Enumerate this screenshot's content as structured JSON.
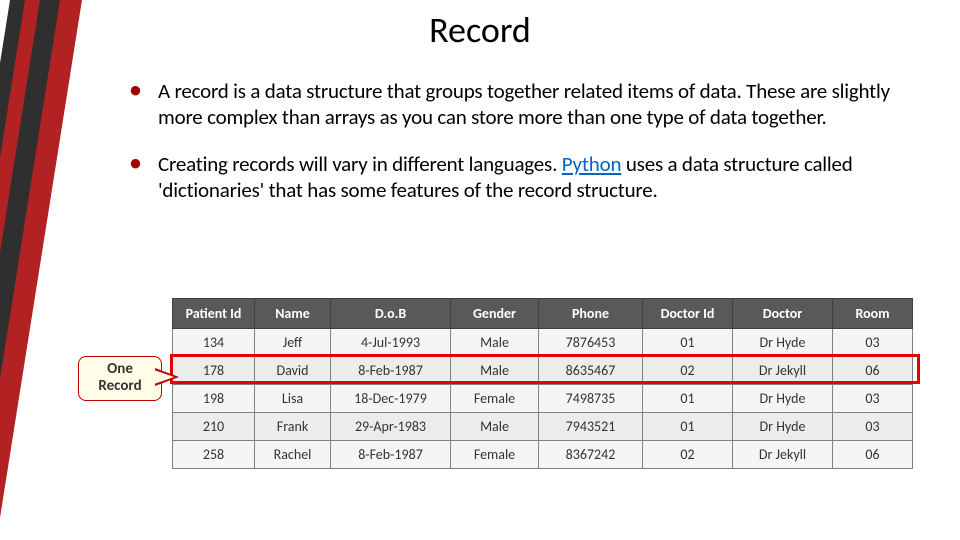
{
  "title": "Record",
  "bullets": [
    {
      "prefix": "A record is a data structure that groups together related items of data. These are slightly more complex than arrays as you can store more than one type of data together."
    },
    {
      "prefix": "Creating records will vary in different languages. ",
      "link_text": "Python",
      "suffix": " uses a data structure called 'dictionaries' that has some features of the record structure."
    }
  ],
  "callout": {
    "line1": "One",
    "line2": "Record"
  },
  "table": {
    "headers": [
      "Patient Id",
      "Name",
      "D.o.B",
      "Gender",
      "Phone",
      "Doctor Id",
      "Doctor",
      "Room"
    ],
    "rows": [
      [
        "134",
        "Jeff",
        "4-Jul-1993",
        "Male",
        "7876453",
        "01",
        "Dr Hyde",
        "03"
      ],
      [
        "178",
        "David",
        "8-Feb-1987",
        "Male",
        "8635467",
        "02",
        "Dr Jekyll",
        "06"
      ],
      [
        "198",
        "Lisa",
        "18-Dec-1979",
        "Female",
        "7498735",
        "01",
        "Dr Hyde",
        "03"
      ],
      [
        "210",
        "Frank",
        "29-Apr-1983",
        "Male",
        "7943521",
        "01",
        "Dr Hyde",
        "03"
      ],
      [
        "258",
        "Rachel",
        "8-Feb-1987",
        "Female",
        "8367242",
        "02",
        "Dr Jekyll",
        "06"
      ]
    ],
    "highlight_row_index": 1
  }
}
